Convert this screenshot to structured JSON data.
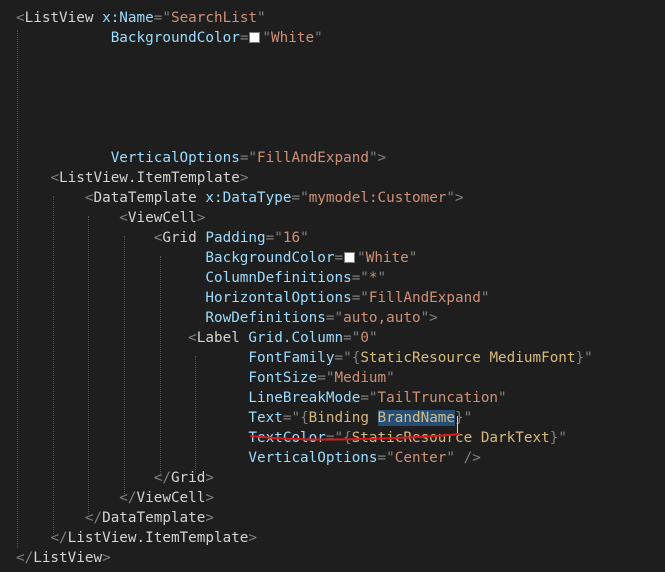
{
  "editor": {
    "background": "#1e1e1e",
    "colors": {
      "punctuation": "#808080",
      "attribute": "#9cdcfe",
      "value": "#ce9178",
      "markup_extension": "#d7ba7d",
      "selection": "#264f78",
      "annotation_underline": "#d7191c"
    },
    "highlighted_word": "BrandName",
    "lines": [
      {
        "indent": 0,
        "tokens": [
          {
            "k": "punc",
            "t": "<"
          },
          {
            "k": "elem",
            "t": "ListView"
          },
          {
            "k": "sp",
            "t": " "
          },
          {
            "k": "attr",
            "t": "x:Name"
          },
          {
            "k": "punc",
            "t": "=\""
          },
          {
            "k": "val",
            "t": "SearchList"
          },
          {
            "k": "punc",
            "t": "\""
          }
        ]
      },
      {
        "indent": 0,
        "tokens": [
          {
            "k": "sp",
            "t": "           "
          },
          {
            "k": "attr",
            "t": "BackgroundColor"
          },
          {
            "k": "punc",
            "t": "="
          },
          {
            "k": "swatch",
            "t": ""
          },
          {
            "k": "punc",
            "t": "\""
          },
          {
            "k": "val",
            "t": "White"
          },
          {
            "k": "punc",
            "t": "\""
          }
        ]
      },
      {
        "indent": 0,
        "tokens": []
      },
      {
        "indent": 0,
        "tokens": []
      },
      {
        "indent": 0,
        "tokens": []
      },
      {
        "indent": 0,
        "tokens": []
      },
      {
        "indent": 0,
        "tokens": []
      },
      {
        "indent": 0,
        "tokens": [
          {
            "k": "sp",
            "t": "           "
          },
          {
            "k": "attr",
            "t": "VerticalOptions"
          },
          {
            "k": "punc",
            "t": "=\""
          },
          {
            "k": "val",
            "t": "FillAndExpand"
          },
          {
            "k": "punc",
            "t": "\">"
          }
        ]
      },
      {
        "indent": 0,
        "tokens": [
          {
            "k": "sp",
            "t": "    "
          },
          {
            "k": "punc",
            "t": "<"
          },
          {
            "k": "elem",
            "t": "ListView.ItemTemplate"
          },
          {
            "k": "punc",
            "t": ">"
          }
        ]
      },
      {
        "indent": 0,
        "tokens": [
          {
            "k": "sp",
            "t": "        "
          },
          {
            "k": "punc",
            "t": "<"
          },
          {
            "k": "elem",
            "t": "DataTemplate"
          },
          {
            "k": "sp",
            "t": " "
          },
          {
            "k": "attr",
            "t": "x:DataType"
          },
          {
            "k": "punc",
            "t": "=\""
          },
          {
            "k": "val",
            "t": "mymodel:Customer"
          },
          {
            "k": "punc",
            "t": "\">"
          }
        ]
      },
      {
        "indent": 0,
        "tokens": [
          {
            "k": "sp",
            "t": "            "
          },
          {
            "k": "punc",
            "t": "<"
          },
          {
            "k": "elem",
            "t": "ViewCell"
          },
          {
            "k": "punc",
            "t": ">"
          }
        ]
      },
      {
        "indent": 0,
        "tokens": [
          {
            "k": "sp",
            "t": "                "
          },
          {
            "k": "punc",
            "t": "<"
          },
          {
            "k": "elem",
            "t": "Grid"
          },
          {
            "k": "sp",
            "t": " "
          },
          {
            "k": "attr",
            "t": "Padding"
          },
          {
            "k": "punc",
            "t": "=\""
          },
          {
            "k": "val",
            "t": "16"
          },
          {
            "k": "punc",
            "t": "\""
          }
        ]
      },
      {
        "indent": 0,
        "tokens": [
          {
            "k": "sp",
            "t": "                      "
          },
          {
            "k": "attr",
            "t": "BackgroundColor"
          },
          {
            "k": "punc",
            "t": "="
          },
          {
            "k": "swatch",
            "t": ""
          },
          {
            "k": "punc",
            "t": "\""
          },
          {
            "k": "val",
            "t": "White"
          },
          {
            "k": "punc",
            "t": "\""
          }
        ]
      },
      {
        "indent": 0,
        "tokens": [
          {
            "k": "sp",
            "t": "                      "
          },
          {
            "k": "attr",
            "t": "ColumnDefinitions"
          },
          {
            "k": "punc",
            "t": "=\""
          },
          {
            "k": "val",
            "t": "*"
          },
          {
            "k": "punc",
            "t": "\""
          }
        ]
      },
      {
        "indent": 0,
        "tokens": [
          {
            "k": "sp",
            "t": "                      "
          },
          {
            "k": "attr",
            "t": "HorizontalOptions"
          },
          {
            "k": "punc",
            "t": "=\""
          },
          {
            "k": "val",
            "t": "FillAndExpand"
          },
          {
            "k": "punc",
            "t": "\""
          }
        ]
      },
      {
        "indent": 0,
        "tokens": [
          {
            "k": "sp",
            "t": "                      "
          },
          {
            "k": "attr",
            "t": "RowDefinitions"
          },
          {
            "k": "punc",
            "t": "=\""
          },
          {
            "k": "val",
            "t": "auto,auto"
          },
          {
            "k": "punc",
            "t": "\">"
          }
        ]
      },
      {
        "indent": 0,
        "tokens": [
          {
            "k": "sp",
            "t": "                    "
          },
          {
            "k": "punc",
            "t": "<"
          },
          {
            "k": "elem",
            "t": "Label"
          },
          {
            "k": "sp",
            "t": " "
          },
          {
            "k": "attr",
            "t": "Grid.Column"
          },
          {
            "k": "punc",
            "t": "=\""
          },
          {
            "k": "val",
            "t": "0"
          },
          {
            "k": "punc",
            "t": "\""
          }
        ]
      },
      {
        "indent": 0,
        "tokens": [
          {
            "k": "sp",
            "t": "                           "
          },
          {
            "k": "attr",
            "t": "FontFamily"
          },
          {
            "k": "punc",
            "t": "=\""
          },
          {
            "k": "punc",
            "t": "{"
          },
          {
            "k": "ext",
            "t": "StaticResource"
          },
          {
            "k": "sp",
            "t": " "
          },
          {
            "k": "attr2",
            "t": "MediumFont"
          },
          {
            "k": "punc",
            "t": "}"
          },
          {
            "k": "punc",
            "t": "\""
          }
        ]
      },
      {
        "indent": 0,
        "tokens": [
          {
            "k": "sp",
            "t": "                           "
          },
          {
            "k": "attr",
            "t": "FontSize"
          },
          {
            "k": "punc",
            "t": "=\""
          },
          {
            "k": "val",
            "t": "Medium"
          },
          {
            "k": "punc",
            "t": "\""
          }
        ]
      },
      {
        "indent": 0,
        "tokens": [
          {
            "k": "sp",
            "t": "                           "
          },
          {
            "k": "attr",
            "t": "LineBreakMode"
          },
          {
            "k": "punc",
            "t": "=\""
          },
          {
            "k": "val",
            "t": "TailTruncation"
          },
          {
            "k": "punc",
            "t": "\""
          }
        ]
      },
      {
        "indent": 0,
        "tokens": [
          {
            "k": "sp",
            "t": "                           "
          },
          {
            "k": "attr",
            "t": "Text"
          },
          {
            "k": "punc",
            "t": "=\""
          },
          {
            "k": "punc",
            "t": "{"
          },
          {
            "k": "ext",
            "t": "Binding"
          },
          {
            "k": "sp",
            "t": " "
          },
          {
            "k": "hl",
            "t": "BrandName"
          },
          {
            "k": "punc",
            "t": "}"
          },
          {
            "k": "punc",
            "t": "\""
          }
        ]
      },
      {
        "indent": 0,
        "tokens": [
          {
            "k": "sp",
            "t": "                           "
          },
          {
            "k": "attr",
            "t": "TextColor"
          },
          {
            "k": "punc",
            "t": "=\""
          },
          {
            "k": "punc",
            "t": "{"
          },
          {
            "k": "ext",
            "t": "StaticResource"
          },
          {
            "k": "sp",
            "t": " "
          },
          {
            "k": "attr2",
            "t": "DarkText"
          },
          {
            "k": "punc",
            "t": "}"
          },
          {
            "k": "punc",
            "t": "\""
          }
        ]
      },
      {
        "indent": 0,
        "tokens": [
          {
            "k": "sp",
            "t": "                           "
          },
          {
            "k": "attr",
            "t": "VerticalOptions"
          },
          {
            "k": "punc",
            "t": "=\""
          },
          {
            "k": "val",
            "t": "Center"
          },
          {
            "k": "punc",
            "t": "\""
          },
          {
            "k": "sp",
            "t": " "
          },
          {
            "k": "punc",
            "t": "/>"
          }
        ]
      },
      {
        "indent": 0,
        "tokens": [
          {
            "k": "sp",
            "t": "                "
          },
          {
            "k": "punc",
            "t": "</"
          },
          {
            "k": "elem",
            "t": "Grid"
          },
          {
            "k": "punc",
            "t": ">"
          }
        ]
      },
      {
        "indent": 0,
        "tokens": [
          {
            "k": "sp",
            "t": "            "
          },
          {
            "k": "punc",
            "t": "</"
          },
          {
            "k": "elem",
            "t": "ViewCell"
          },
          {
            "k": "punc",
            "t": ">"
          }
        ]
      },
      {
        "indent": 0,
        "tokens": [
          {
            "k": "sp",
            "t": "        "
          },
          {
            "k": "punc",
            "t": "</"
          },
          {
            "k": "elem",
            "t": "DataTemplate"
          },
          {
            "k": "punc",
            "t": ">"
          }
        ]
      },
      {
        "indent": 0,
        "tokens": [
          {
            "k": "sp",
            "t": "    "
          },
          {
            "k": "punc",
            "t": "</"
          },
          {
            "k": "elem",
            "t": "ListView.ItemTemplate"
          },
          {
            "k": "punc",
            "t": ">"
          }
        ]
      },
      {
        "indent": 0,
        "tokens": [
          {
            "k": "punc",
            "t": "</"
          },
          {
            "k": "elem",
            "t": "ListView"
          },
          {
            "k": "punc",
            "t": ">"
          }
        ]
      }
    ]
  }
}
